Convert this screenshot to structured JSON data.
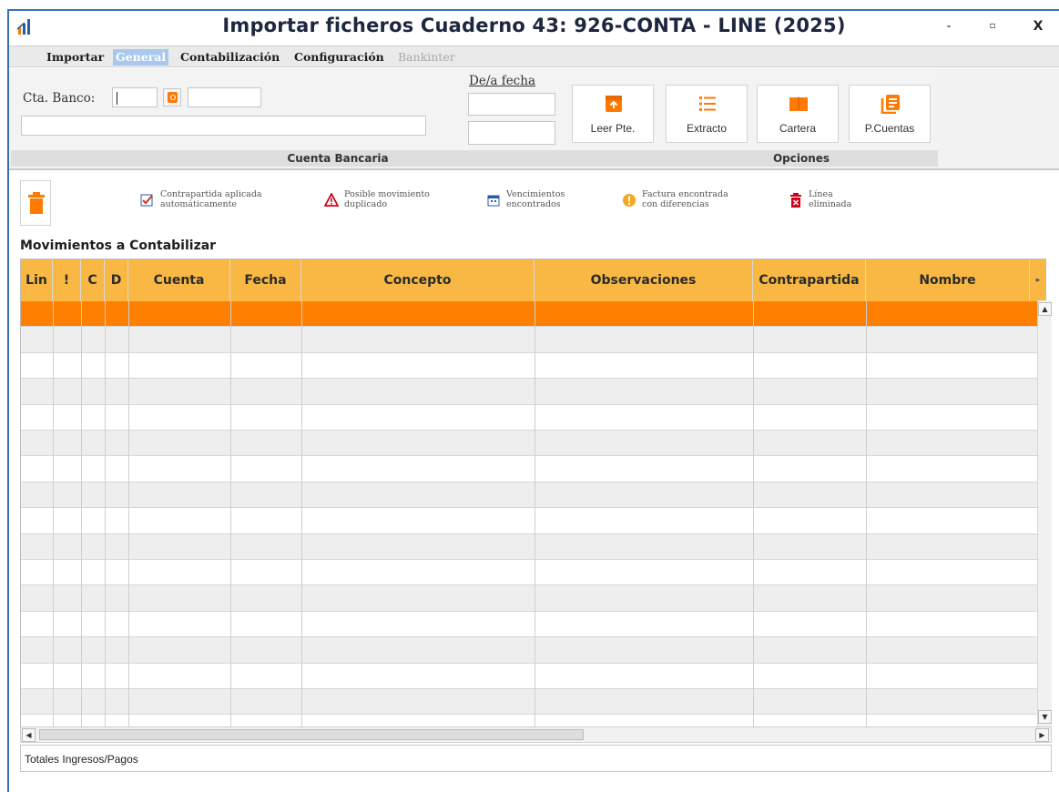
{
  "window": {
    "title": "Importar ficheros Cuaderno 43: 926-CONTA - LINE (2025)",
    "minimize": "-",
    "maximize": "▫",
    "close": "X"
  },
  "menu": {
    "items": [
      {
        "label": "Importar",
        "state": "normal"
      },
      {
        "label": "General",
        "state": "active"
      },
      {
        "label": "Contabilización",
        "state": "normal"
      },
      {
        "label": "Configuración",
        "state": "normal"
      },
      {
        "label": "Bankinter",
        "state": "disabled"
      }
    ]
  },
  "bank": {
    "label": "Cta. Banco:",
    "account_value": "",
    "account_name_value": "",
    "description_value": "",
    "section_caption": "Cuenta Bancaria"
  },
  "dates": {
    "label": "De/a fecha",
    "from_value": "",
    "to_value": ""
  },
  "toolbar": {
    "read_button": "Leer Pte.",
    "statement_button": "Extracto",
    "portfolio_button": "Cartera",
    "accounts_button": "P.Cuentas",
    "options_caption": "Opciones"
  },
  "legend": {
    "auto_counterpart": "Contrapartida aplicada\nautomáticamente",
    "possible_duplicate": "Posible movimiento\nduplicado",
    "due_dates_found": "Vencimientos\nencontrados",
    "invoice_differences": "Factura encontrada\ncon diferencias",
    "line_deleted": "Línea\neliminada"
  },
  "grid": {
    "title": "Movimientos a Contabilizar",
    "columns": [
      "Lin",
      "!",
      "C",
      "D",
      "Cuenta",
      "Fecha",
      "Concepto",
      "Observaciones",
      "Contrapartida",
      "Nombre"
    ],
    "rows": []
  },
  "footer": {
    "totals_label": "Totales Ingresos/Pagos"
  },
  "colors": {
    "accent_orange": "#ff7f00",
    "header_orange": "#f9b843",
    "active_tab": "#a9c8ee",
    "title_text": "#1e2740"
  },
  "icons": {
    "app": "app-logo-icon",
    "lookup": "lookup-icon",
    "read_pending": "download-box-icon",
    "statement": "list-icon",
    "portfolio": "book-icon",
    "accounts": "ledger-icon",
    "delete": "trash-icon",
    "auto_counterpart": "checked-document-icon",
    "possible_duplicate": "warning-triangle-icon",
    "due_dates": "calendar-icon",
    "invoice_differences": "exclamation-circle-icon",
    "line_deleted": "deleted-line-icon"
  }
}
